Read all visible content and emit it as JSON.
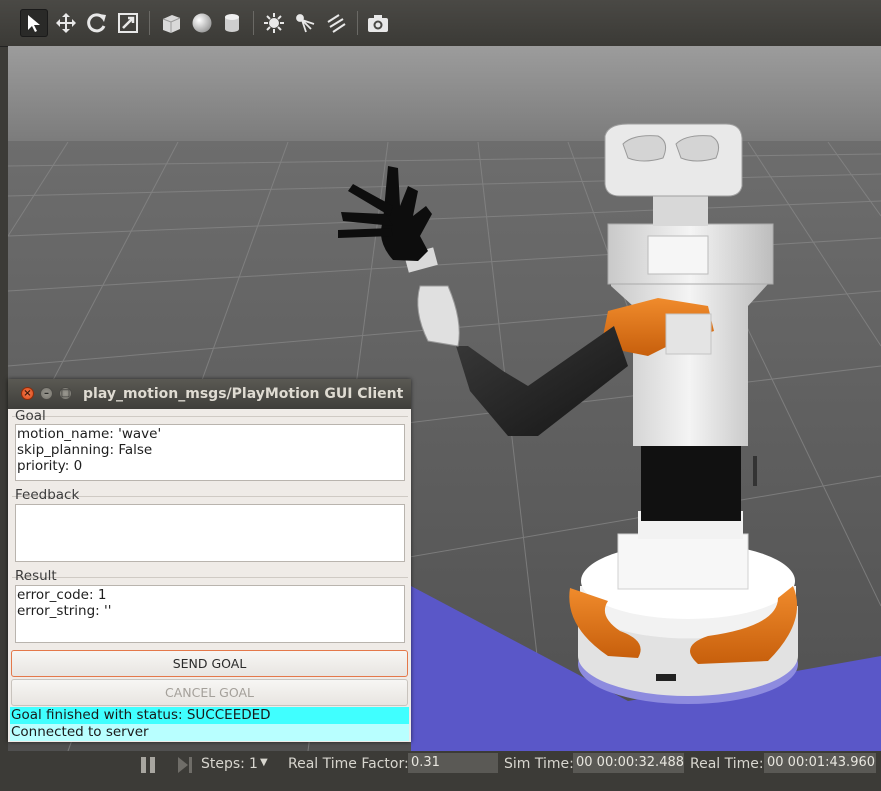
{
  "toolbar": {
    "icons": [
      "select-arrow-icon",
      "translate-icon",
      "rotate-icon",
      "scale-icon",
      "box-icon",
      "sphere-icon",
      "cylinder-icon",
      "point-light-icon",
      "spot-light-icon",
      "directional-light-icon",
      "screenshot-icon"
    ]
  },
  "window": {
    "title": "play_motion_msgs/PlayMotion GUI Client",
    "close_glyph": "×",
    "min_glyph": "–",
    "max_glyph": "□",
    "goal": {
      "label": "Goal",
      "lines": [
        "motion_name: 'wave'",
        "skip_planning: False",
        "priority: 0"
      ]
    },
    "feedback": {
      "label": "Feedback",
      "lines": []
    },
    "result": {
      "label": "Result",
      "lines": [
        "error_code: 1",
        "error_string: ''"
      ]
    },
    "send_goal_label": "SEND GOAL",
    "cancel_goal_label": "CANCEL GOAL",
    "goal_status": "Goal finished with status: SUCCEEDED",
    "server_status": "Connected to server",
    "status_colors": {
      "goal": "#40ffff",
      "server": "#b8ffff"
    }
  },
  "statusbar": {
    "steps_label": "Steps:",
    "steps_value": "1",
    "rtf_label": "Real Time Factor:",
    "rtf_value": "0.31",
    "sim_time_label": "Sim Time:",
    "sim_time_value": "00 00:00:32.488",
    "real_time_label": "Real Time:",
    "real_time_value": "00 00:01:43.960"
  },
  "colors": {
    "accent_orange": "#e07b1e",
    "floor_blue": "#5a57c8",
    "sky_grey": "#8c8c8c"
  }
}
